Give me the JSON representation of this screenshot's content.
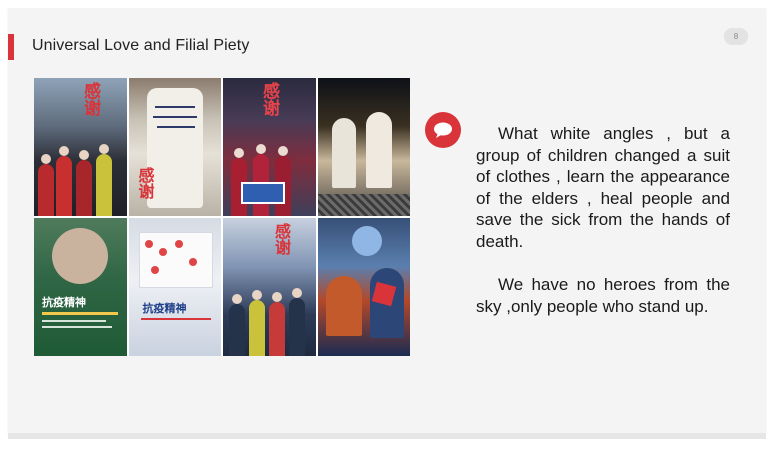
{
  "slide": {
    "title": "Universal Love and Filial Piety",
    "page_number": "8",
    "accent_color": "#d9343a",
    "background_color": "#f4f4f4"
  },
  "collage": {
    "tiles": [
      {
        "name": "poster-medics-red-jackets",
        "caption": "感\n谢"
      },
      {
        "name": "signed-protective-suit",
        "caption": "感\n谢"
      },
      {
        "name": "poster-nurses-holding-flag",
        "caption": "感\n谢"
      },
      {
        "name": "photo-medics-silhouettes",
        "caption": ""
      },
      {
        "name": "poster-doctor-portrait",
        "caption": "抗疫精神"
      },
      {
        "name": "poster-red-fingerprints-letter",
        "caption": "抗疫精神"
      },
      {
        "name": "poster-police-officers",
        "caption": "感\n谢"
      },
      {
        "name": "illustration-medics-hero",
        "caption": ""
      }
    ]
  },
  "text": {
    "icon": "speech-bubble-icon",
    "paragraph_1": "What white angles , but a group of children changed a suit of clothes , learn the appearance of the elders , heal people and save the sick from the hands of death.",
    "paragraph_2": "We have no heroes from the sky ,only people who stand up."
  }
}
